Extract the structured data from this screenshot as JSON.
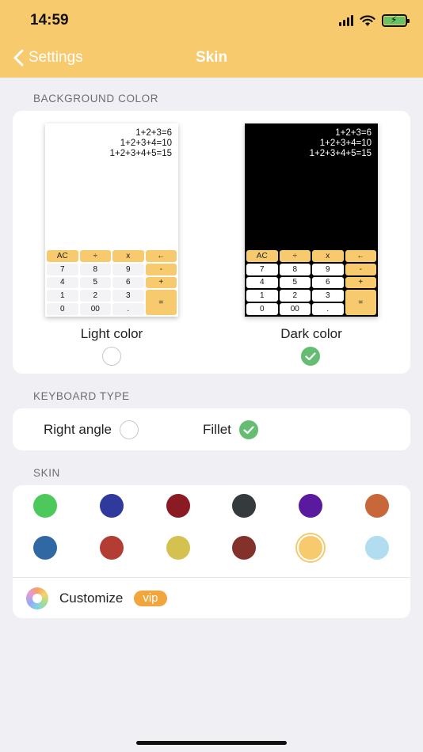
{
  "status_bar": {
    "time": "14:59"
  },
  "nav": {
    "back_label": "Settings",
    "title": "Skin"
  },
  "background_color": {
    "section_label": "BACKGROUND COLOR",
    "formula_lines": [
      "1+2+3=6",
      "1+2+3+4=10",
      "1+2+3+4+5=15"
    ],
    "keys": {
      "ac": "AC",
      "divide": "÷",
      "multiply": "x",
      "backspace": "←",
      "seven": "7",
      "eight": "8",
      "nine": "9",
      "minus": "-",
      "four": "4",
      "five": "5",
      "six": "6",
      "plus": "+",
      "one": "1",
      "two": "2",
      "three": "3",
      "equals": "=",
      "zero": "0",
      "double_zero": "00",
      "dot": "."
    },
    "options": [
      {
        "label": "Light color",
        "selected": false
      },
      {
        "label": "Dark color",
        "selected": true
      }
    ]
  },
  "keyboard_type": {
    "section_label": "KEYBOARD TYPE",
    "options": [
      {
        "label": "Right angle",
        "selected": false
      },
      {
        "label": "Fillet",
        "selected": true
      }
    ]
  },
  "skin": {
    "section_label": "SKIN",
    "colors": [
      "#4dc85a",
      "#2f3a9c",
      "#8b1a22",
      "#353a3d",
      "#5a1aa0",
      "#c8683a",
      "#2f68a3",
      "#b33d33",
      "#d5c150",
      "#84302b",
      "#f8ca6e",
      "#b2dcef"
    ],
    "selected_index": 10,
    "customize_label": "Customize",
    "vip_badge": "vip"
  },
  "theme": {
    "accent": "#f8ca6e",
    "check_green": "#65bd73",
    "vip_orange": "#f2a53c"
  }
}
